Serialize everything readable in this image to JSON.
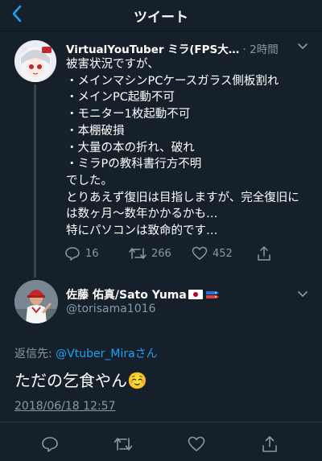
{
  "header": {
    "title": "ツイート",
    "back_icon": "chevron-left-icon"
  },
  "tweet1": {
    "display_name": "VirtualYouTuber ミラ(FPS大…",
    "time": "· 2時間",
    "text": "被害状況ですが、\n・メインマシンPCケースガラス側板割れ\n・メインPC起動不可\n・モニター1枚起動不可\n・本棚破損\n・大量の本の折れ、破れ\n・ミラPの教科書行方不明\nでした。\nとりあえず復旧は目指しますが、完全復旧には数ヶ月〜数年かかるかも…\n特にパソコンは致命的です…",
    "replies": "16",
    "retweets": "266",
    "likes": "452"
  },
  "tweet2": {
    "display_name": "佐藤 佑真/Sato Yuma",
    "handle": "@torisama1016",
    "reply_prefix": "返信先: ",
    "reply_mention": "@Vtuber_Miraさん",
    "text": "ただの乞食やん☺️",
    "date": "2018/06/18 12:57"
  },
  "colors": {
    "background": "#15202b",
    "accent": "#1da1f2",
    "muted": "#8899a6"
  }
}
